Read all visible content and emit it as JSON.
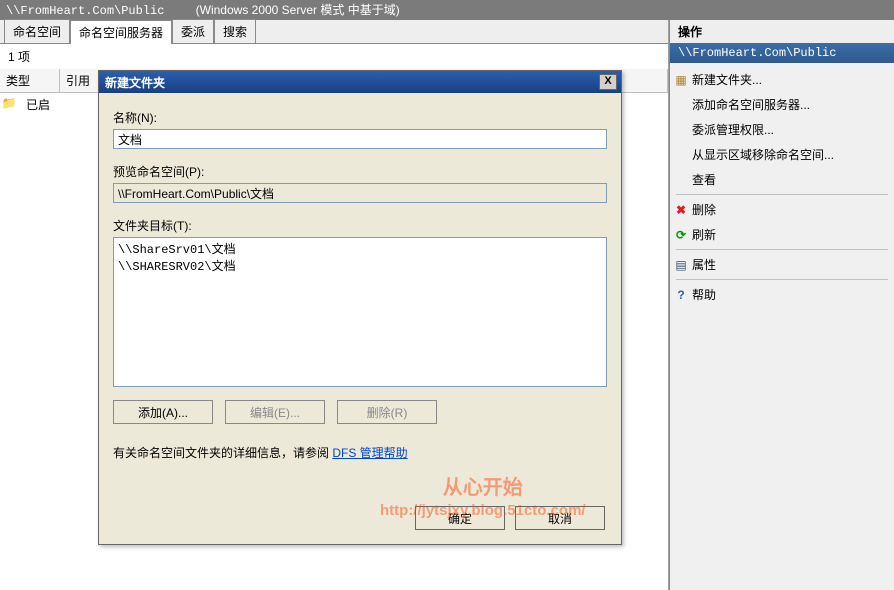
{
  "titlebar": {
    "path": "\\\\FromHeart.Com\\Public",
    "mode": "(Windows 2000 Server 模式 中基于域)"
  },
  "tabs": [
    "命名空间",
    "命名空间服务器",
    "委派",
    "搜索"
  ],
  "active_tab": 1,
  "count_line": "1 项",
  "list": {
    "cols": [
      "类型",
      "引用"
    ],
    "row_icon": "folder",
    "row_text": "已启"
  },
  "dialog": {
    "title": "新建文件夹",
    "name_label": "名称(N):",
    "name_value": "文档",
    "preview_label": "预览命名空间(P):",
    "preview_value": "\\\\FromHeart.Com\\Public\\文档",
    "targets_label": "文件夹目标(T):",
    "targets_value": "\\\\ShareSrv01\\文档\n\\\\SHARESRV02\\文档",
    "btn_add": "添加(A)...",
    "btn_edit": "编辑(E)...",
    "btn_del": "删除(R)",
    "help_prefix": "有关命名空间文件夹的详细信息，请参阅 ",
    "help_link": "DFS 管理帮助",
    "ok": "确定",
    "cancel": "取消",
    "close": "X"
  },
  "panel": {
    "head": "操作",
    "subhead": "\\\\FromHeart.Com\\Public",
    "items": [
      {
        "icon": "newfolder",
        "text": "新建文件夹..."
      },
      {
        "icon": "",
        "text": "添加命名空间服务器..."
      },
      {
        "icon": "",
        "text": "委派管理权限..."
      },
      {
        "icon": "",
        "text": "从显示区域移除命名空间..."
      },
      {
        "icon": "",
        "text": "查看"
      },
      {
        "sep": true
      },
      {
        "icon": "crossX",
        "text": "删除"
      },
      {
        "icon": "ref",
        "text": "刷新"
      },
      {
        "sep": true
      },
      {
        "icon": "prop",
        "text": "属性"
      },
      {
        "sep": true
      },
      {
        "icon": "help",
        "text": "帮助"
      }
    ]
  },
  "watermark": {
    "line1": "从心开始",
    "line2": "http://jytsjxy.blog.51cto.com/"
  }
}
